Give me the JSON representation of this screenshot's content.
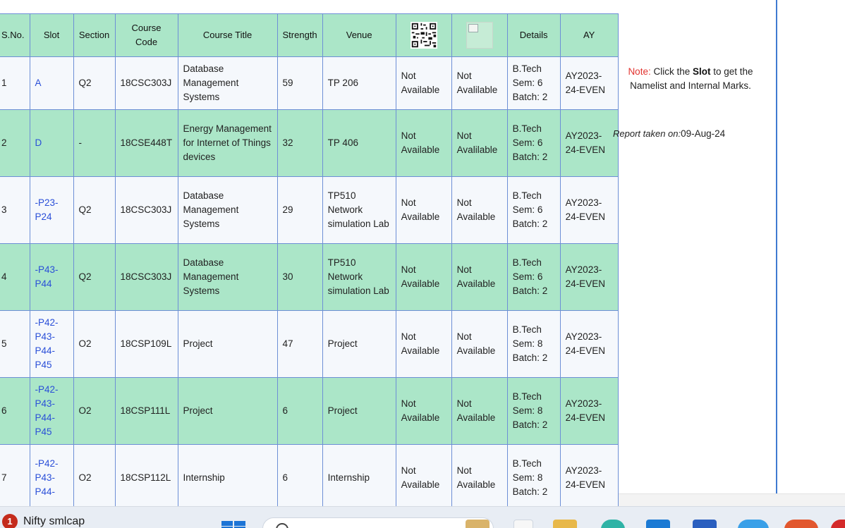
{
  "table": {
    "headers": {
      "sno": "S.No.",
      "slot": "Slot",
      "section": "Section",
      "course_code": "Course Code",
      "course_title": "Course Title",
      "strength": "Strength",
      "venue": "Venue",
      "qr": "qr-code-icon",
      "photo": "broken-image-icon",
      "details": "Details",
      "ay": "AY"
    },
    "rows": [
      {
        "sno": "1",
        "slot": "A",
        "section": "Q2",
        "code": "18CSC303J",
        "title": "Database Management Systems",
        "strength": "59",
        "venue": "TP 206",
        "qr": "Not Available",
        "photo": "Not Avalilable",
        "details": "B.Tech Sem: 6 Batch: 2",
        "ay": "AY2023-24-EVEN"
      },
      {
        "sno": "2",
        "slot": "D",
        "section": "-",
        "code": "18CSE448T",
        "title": "Energy Management for Internet of Things devices",
        "strength": "32",
        "venue": "TP 406",
        "qr": "Not Available",
        "photo": "Not Avalilable",
        "details": "B.Tech Sem: 6 Batch: 2",
        "ay": "AY2023-24-EVEN"
      },
      {
        "sno": "3",
        "slot": "-P23-P24",
        "section": "Q2",
        "code": "18CSC303J",
        "title": "Database Management Systems",
        "strength": "29",
        "venue": "TP510 Network simulation Lab",
        "qr": "Not Available",
        "photo": "Not Available",
        "details": "B.Tech Sem: 6 Batch: 2",
        "ay": "AY2023-24-EVEN"
      },
      {
        "sno": "4",
        "slot": "-P43-P44",
        "section": "Q2",
        "code": "18CSC303J",
        "title": "Database Management Systems",
        "strength": "30",
        "venue": "TP510 Network simulation Lab",
        "qr": "Not Available",
        "photo": "Not Available",
        "details": "B.Tech Sem: 6 Batch: 2",
        "ay": "AY2023-24-EVEN"
      },
      {
        "sno": "5",
        "slot": "-P42-P43-P44-P45",
        "section": "O2",
        "code": "18CSP109L",
        "title": "Project",
        "strength": "47",
        "venue": "Project",
        "qr": "Not Available",
        "photo": "Not Available",
        "details": "B.Tech Sem: 8 Batch: 2",
        "ay": "AY2023-24-EVEN"
      },
      {
        "sno": "6",
        "slot": "-P42-P43-P44-P45",
        "section": "O2",
        "code": "18CSP111L",
        "title": "Project",
        "strength": "6",
        "venue": "Project",
        "qr": "Not Available",
        "photo": "Not Available",
        "details": "B.Tech Sem: 8 Batch: 2",
        "ay": "AY2023-24-EVEN"
      },
      {
        "sno": "7",
        "slot": "-P42-P43-P44-",
        "section": "O2",
        "code": "18CSP112L",
        "title": "Internship",
        "strength": "6",
        "venue": "Internship",
        "qr": "Not Available",
        "photo": "Not Available",
        "details": "B.Tech Sem: 8 Batch: 2",
        "ay": "AY2023-24-EVEN"
      }
    ]
  },
  "note": {
    "label": "Note:",
    "text_before": " Click the ",
    "slot_word": "Slot",
    "text_after": " to get the Namelist and Internal Marks."
  },
  "report": {
    "label": "Report taken on:",
    "date": "09-Aug-24"
  },
  "taskbar": {
    "notification_count": "1",
    "widget_text": "Nifty smlcap",
    "icons": [
      "windows-start-icon",
      "search-icon",
      "file-explorer-icon",
      "edge-browser-icon",
      "mail-icon",
      "store-icon",
      "chrome-icon"
    ]
  }
}
